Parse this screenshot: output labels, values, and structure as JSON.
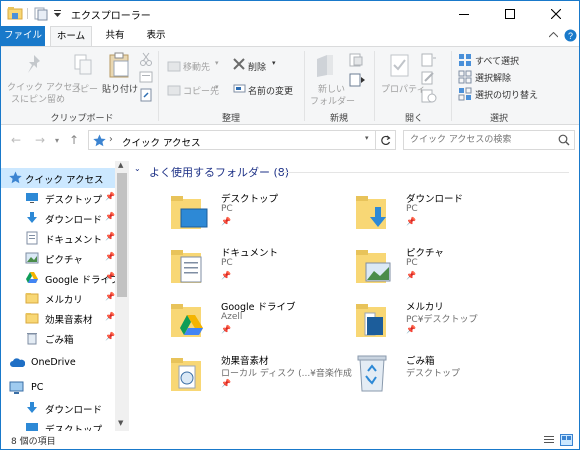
{
  "window": {
    "title": "エクスプローラー"
  },
  "ribbon_tabs": {
    "file": "ファイル",
    "home": "ホーム",
    "share": "共有",
    "view": "表示"
  },
  "ribbon": {
    "pin_quick_access_line1": "クイック アクセス",
    "pin_quick_access_line2": "スにピン留め",
    "copy": "コピー",
    "paste": "貼り付け",
    "clipboard_group": "クリップボード",
    "move_to": "移動先",
    "copy_to": "コピー先",
    "delete": "削除",
    "rename": "名前の変更",
    "organize_group": "整理",
    "new_folder_line1": "新しい",
    "new_folder_line2": "フォルダー",
    "new_group": "新規",
    "properties": "プロパティ",
    "open_group": "開く",
    "select_all": "すべて選択",
    "select_none": "選択解除",
    "invert_selection": "選択の切り替え",
    "select_group": "選択"
  },
  "address": {
    "path": "クイック アクセス",
    "search_placeholder": "クイック アクセスの検索"
  },
  "nav_pane": {
    "quick_access": "クイック アクセス",
    "items": [
      {
        "label": "デスクトップ",
        "icon": "desktop-icon"
      },
      {
        "label": "ダウンロード",
        "icon": "download-icon"
      },
      {
        "label": "ドキュメント",
        "icon": "document-icon"
      },
      {
        "label": "ピクチャ",
        "icon": "picture-icon"
      },
      {
        "label": "Google ドライブ",
        "icon": "google-drive-icon"
      },
      {
        "label": "メルカリ",
        "icon": "folder-icon"
      },
      {
        "label": "効果音素材",
        "icon": "folder-icon"
      },
      {
        "label": "ごみ箱",
        "icon": "recycle-bin-icon"
      }
    ],
    "onedrive": "OneDrive",
    "pc": "PC",
    "pc_items": [
      {
        "label": "ダウンロード",
        "icon": "download-icon"
      },
      {
        "label": "デスクトップ",
        "icon": "desktop-icon"
      }
    ]
  },
  "content": {
    "group_header": "よく使用するフォルダー (8)",
    "tiles": [
      {
        "name": "デスクトップ",
        "sub": "PC",
        "icon": "desktop-folder-icon"
      },
      {
        "name": "ダウンロード",
        "sub": "PC",
        "icon": "download-folder-icon"
      },
      {
        "name": "ドキュメント",
        "sub": "PC",
        "icon": "document-folder-icon"
      },
      {
        "name": "ピクチャ",
        "sub": "PC",
        "icon": "picture-folder-icon"
      },
      {
        "name": "Google ドライブ",
        "sub": "Azell",
        "icon": "google-drive-folder-icon"
      },
      {
        "name": "メルカリ",
        "sub": "PC¥デスクトップ",
        "icon": "folder-icon"
      },
      {
        "name": "効果音素材",
        "sub": "ローカル ディスク (...¥音楽作成",
        "icon": "audio-folder-icon"
      },
      {
        "name": "ごみ箱",
        "sub": "デスクトップ",
        "icon": "recycle-bin-icon"
      }
    ]
  },
  "status": {
    "item_count": "8 個の項目"
  },
  "colors": {
    "accent": "#1979ca",
    "selected_bg": "#cce8ff",
    "folder_yellow": "#f8d775",
    "group_header": "#1e3287"
  }
}
